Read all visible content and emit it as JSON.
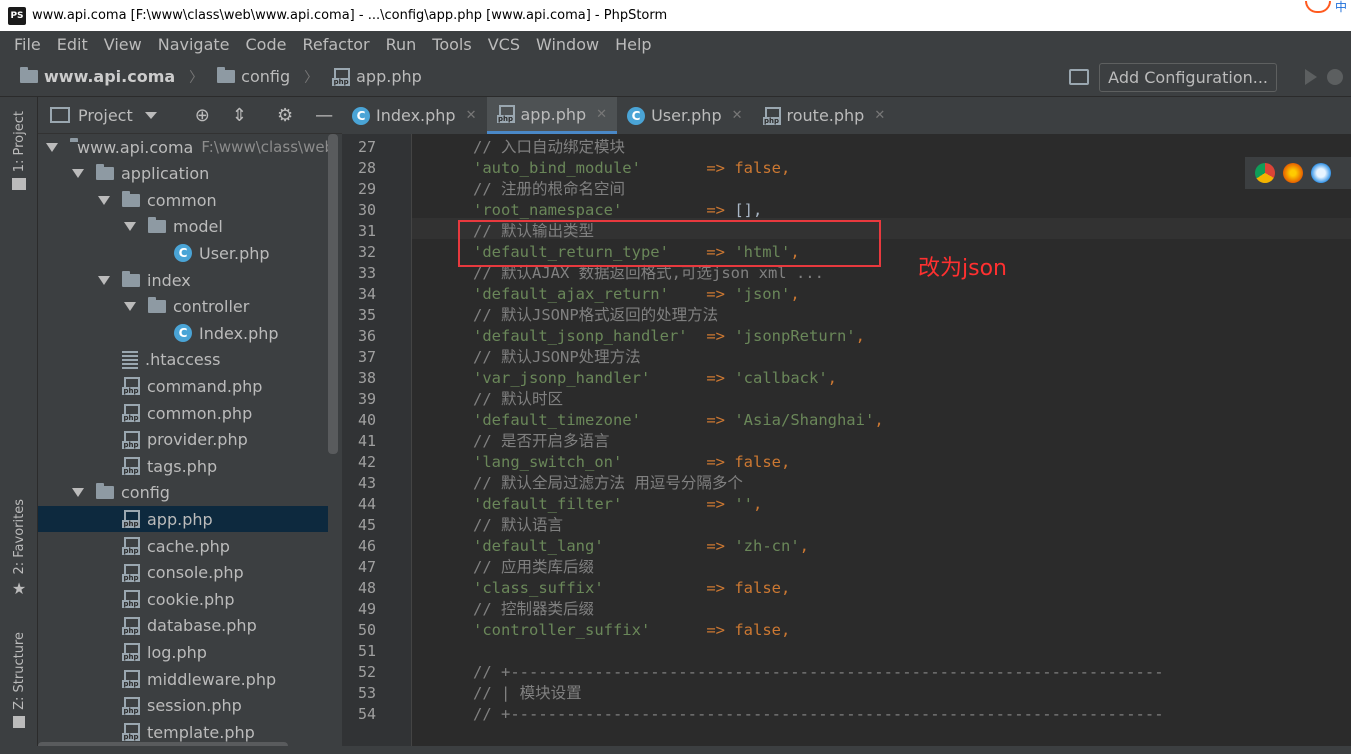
{
  "window": {
    "title": "www.api.coma [F:\\www\\class\\web\\www.api.coma] - ...\\config\\app.php [www.api.coma] - PhpStorm",
    "app_badge": "PS",
    "ime_label": "中"
  },
  "menu": [
    "File",
    "Edit",
    "View",
    "Navigate",
    "Code",
    "Refactor",
    "Run",
    "Tools",
    "VCS",
    "Window",
    "Help"
  ],
  "breadcrumb": [
    "www.api.coma",
    "config",
    "app.php"
  ],
  "toolbar": {
    "add_configuration": "Add Configuration..."
  },
  "left_strip": {
    "project": "1: Project",
    "favorites": "2: Favorites",
    "structure": "Z: Structure"
  },
  "project_panel": {
    "title": "Project"
  },
  "tree": [
    {
      "label": "www.api.coma",
      "path": "F:\\www\\class\\web",
      "type": "folder",
      "level": 0,
      "expanded": true
    },
    {
      "label": "application",
      "type": "folder",
      "level": 1,
      "expanded": true
    },
    {
      "label": "common",
      "type": "folder",
      "level": 2,
      "expanded": true
    },
    {
      "label": "model",
      "type": "folder",
      "level": 3,
      "expanded": true
    },
    {
      "label": "User.php",
      "type": "class",
      "level": 4
    },
    {
      "label": "index",
      "type": "folder",
      "level": 2,
      "expanded": true
    },
    {
      "label": "controller",
      "type": "folder",
      "level": 3,
      "expanded": true
    },
    {
      "label": "Index.php",
      "type": "class",
      "level": 4
    },
    {
      "label": ".htaccess",
      "type": "htaccess",
      "level": 2
    },
    {
      "label": "command.php",
      "type": "php",
      "level": 2
    },
    {
      "label": "common.php",
      "type": "php",
      "level": 2
    },
    {
      "label": "provider.php",
      "type": "php",
      "level": 2
    },
    {
      "label": "tags.php",
      "type": "php",
      "level": 2
    },
    {
      "label": "config",
      "type": "folder",
      "level": 1,
      "expanded": true
    },
    {
      "label": "app.php",
      "type": "php",
      "level": 2,
      "selected": true
    },
    {
      "label": "cache.php",
      "type": "php",
      "level": 2
    },
    {
      "label": "console.php",
      "type": "php",
      "level": 2
    },
    {
      "label": "cookie.php",
      "type": "php",
      "level": 2
    },
    {
      "label": "database.php",
      "type": "php",
      "level": 2
    },
    {
      "label": "log.php",
      "type": "php",
      "level": 2
    },
    {
      "label": "middleware.php",
      "type": "php",
      "level": 2
    },
    {
      "label": "session.php",
      "type": "php",
      "level": 2
    },
    {
      "label": "template.php",
      "type": "php",
      "level": 2
    }
  ],
  "tabs": [
    {
      "label": "Index.php",
      "icon": "class",
      "active": false
    },
    {
      "label": "app.php",
      "icon": "php",
      "active": true
    },
    {
      "label": "User.php",
      "icon": "class",
      "active": false
    },
    {
      "label": "route.php",
      "icon": "php",
      "active": false
    }
  ],
  "code": [
    {
      "ln": "27",
      "parts": [
        {
          "t": "// 入口自动绑定模块",
          "c": "cm"
        }
      ]
    },
    {
      "ln": "28",
      "parts": [
        {
          "t": "'auto_bind_module'",
          "c": "str"
        },
        {
          "t": "       ",
          "c": "pl"
        },
        {
          "t": "=>",
          "c": "op"
        },
        {
          "t": " ",
          "c": "pl"
        },
        {
          "t": "false",
          "c": "op"
        },
        {
          "t": ",",
          "c": "op"
        }
      ]
    },
    {
      "ln": "29",
      "parts": [
        {
          "t": "// 注册的根命名空间",
          "c": "cm"
        }
      ]
    },
    {
      "ln": "30",
      "parts": [
        {
          "t": "'root_namespace'",
          "c": "str"
        },
        {
          "t": "         ",
          "c": "pl"
        },
        {
          "t": "=>",
          "c": "op"
        },
        {
          "t": " [],",
          "c": "pl"
        }
      ]
    },
    {
      "ln": "31",
      "parts": [
        {
          "t": "// 默认输出类型",
          "c": "cm"
        }
      ]
    },
    {
      "ln": "32",
      "parts": [
        {
          "t": "'default_return_type'",
          "c": "str"
        },
        {
          "t": "    ",
          "c": "pl"
        },
        {
          "t": "=>",
          "c": "op"
        },
        {
          "t": " ",
          "c": "pl"
        },
        {
          "t": "'html'",
          "c": "str"
        },
        {
          "t": ",",
          "c": "op"
        }
      ]
    },
    {
      "ln": "33",
      "parts": [
        {
          "t": "// 默认AJAX 数据返回格式,可选json xml ...",
          "c": "cm"
        }
      ]
    },
    {
      "ln": "34",
      "parts": [
        {
          "t": "'default_ajax_return'",
          "c": "str"
        },
        {
          "t": "    ",
          "c": "pl"
        },
        {
          "t": "=>",
          "c": "op"
        },
        {
          "t": " ",
          "c": "pl"
        },
        {
          "t": "'json'",
          "c": "str"
        },
        {
          "t": ",",
          "c": "op"
        }
      ]
    },
    {
      "ln": "35",
      "parts": [
        {
          "t": "// 默认JSONP格式返回的处理方法",
          "c": "cm"
        }
      ]
    },
    {
      "ln": "36",
      "parts": [
        {
          "t": "'default_jsonp_handler'",
          "c": "str"
        },
        {
          "t": "  ",
          "c": "pl"
        },
        {
          "t": "=>",
          "c": "op"
        },
        {
          "t": " ",
          "c": "pl"
        },
        {
          "t": "'jsonpReturn'",
          "c": "str"
        },
        {
          "t": ",",
          "c": "op"
        }
      ]
    },
    {
      "ln": "37",
      "parts": [
        {
          "t": "// 默认JSONP处理方法",
          "c": "cm"
        }
      ]
    },
    {
      "ln": "38",
      "parts": [
        {
          "t": "'var_jsonp_handler'",
          "c": "str"
        },
        {
          "t": "      ",
          "c": "pl"
        },
        {
          "t": "=>",
          "c": "op"
        },
        {
          "t": " ",
          "c": "pl"
        },
        {
          "t": "'callback'",
          "c": "str"
        },
        {
          "t": ",",
          "c": "op"
        }
      ]
    },
    {
      "ln": "39",
      "parts": [
        {
          "t": "// 默认时区",
          "c": "cm"
        }
      ]
    },
    {
      "ln": "40",
      "parts": [
        {
          "t": "'default_timezone'",
          "c": "str"
        },
        {
          "t": "       ",
          "c": "pl"
        },
        {
          "t": "=>",
          "c": "op"
        },
        {
          "t": " ",
          "c": "pl"
        },
        {
          "t": "'Asia/Shanghai'",
          "c": "str"
        },
        {
          "t": ",",
          "c": "op"
        }
      ]
    },
    {
      "ln": "41",
      "parts": [
        {
          "t": "// 是否开启多语言",
          "c": "cm"
        }
      ]
    },
    {
      "ln": "42",
      "parts": [
        {
          "t": "'lang_switch_on'",
          "c": "str"
        },
        {
          "t": "         ",
          "c": "pl"
        },
        {
          "t": "=>",
          "c": "op"
        },
        {
          "t": " ",
          "c": "pl"
        },
        {
          "t": "false",
          "c": "op"
        },
        {
          "t": ",",
          "c": "op"
        }
      ]
    },
    {
      "ln": "43",
      "parts": [
        {
          "t": "// 默认全局过滤方法 用逗号分隔多个",
          "c": "cm"
        }
      ]
    },
    {
      "ln": "44",
      "parts": [
        {
          "t": "'default_filter'",
          "c": "str"
        },
        {
          "t": "         ",
          "c": "pl"
        },
        {
          "t": "=>",
          "c": "op"
        },
        {
          "t": " ",
          "c": "pl"
        },
        {
          "t": "''",
          "c": "str"
        },
        {
          "t": ",",
          "c": "op"
        }
      ]
    },
    {
      "ln": "45",
      "parts": [
        {
          "t": "// 默认语言",
          "c": "cm"
        }
      ]
    },
    {
      "ln": "46",
      "parts": [
        {
          "t": "'default_lang'",
          "c": "str"
        },
        {
          "t": "           ",
          "c": "pl"
        },
        {
          "t": "=>",
          "c": "op"
        },
        {
          "t": " ",
          "c": "pl"
        },
        {
          "t": "'zh-cn'",
          "c": "str"
        },
        {
          "t": ",",
          "c": "op"
        }
      ]
    },
    {
      "ln": "47",
      "parts": [
        {
          "t": "// 应用类库后缀",
          "c": "cm"
        }
      ]
    },
    {
      "ln": "48",
      "parts": [
        {
          "t": "'class_suffix'",
          "c": "str"
        },
        {
          "t": "           ",
          "c": "pl"
        },
        {
          "t": "=>",
          "c": "op"
        },
        {
          "t": " ",
          "c": "pl"
        },
        {
          "t": "false",
          "c": "op"
        },
        {
          "t": ",",
          "c": "op"
        }
      ]
    },
    {
      "ln": "49",
      "parts": [
        {
          "t": "// 控制器类后缀",
          "c": "cm"
        }
      ]
    },
    {
      "ln": "50",
      "parts": [
        {
          "t": "'controller_suffix'",
          "c": "str"
        },
        {
          "t": "      ",
          "c": "pl"
        },
        {
          "t": "=>",
          "c": "op"
        },
        {
          "t": " ",
          "c": "pl"
        },
        {
          "t": "false",
          "c": "op"
        },
        {
          "t": ",",
          "c": "op"
        }
      ]
    },
    {
      "ln": "51",
      "parts": []
    },
    {
      "ln": "52",
      "parts": [
        {
          "t": "// +----------------------------------------------------------------------",
          "c": "cm"
        }
      ]
    },
    {
      "ln": "53",
      "parts": [
        {
          "t": "// | 模块设置",
          "c": "cm"
        }
      ]
    },
    {
      "ln": "54",
      "parts": [
        {
          "t": "// +----------------------------------------------------------------------",
          "c": "cm"
        }
      ]
    }
  ],
  "annotation": "改为json",
  "colors": {
    "annotation": "#ff3030",
    "highlight_box": "#e8393e",
    "tab_accent": "#4a88c7"
  }
}
